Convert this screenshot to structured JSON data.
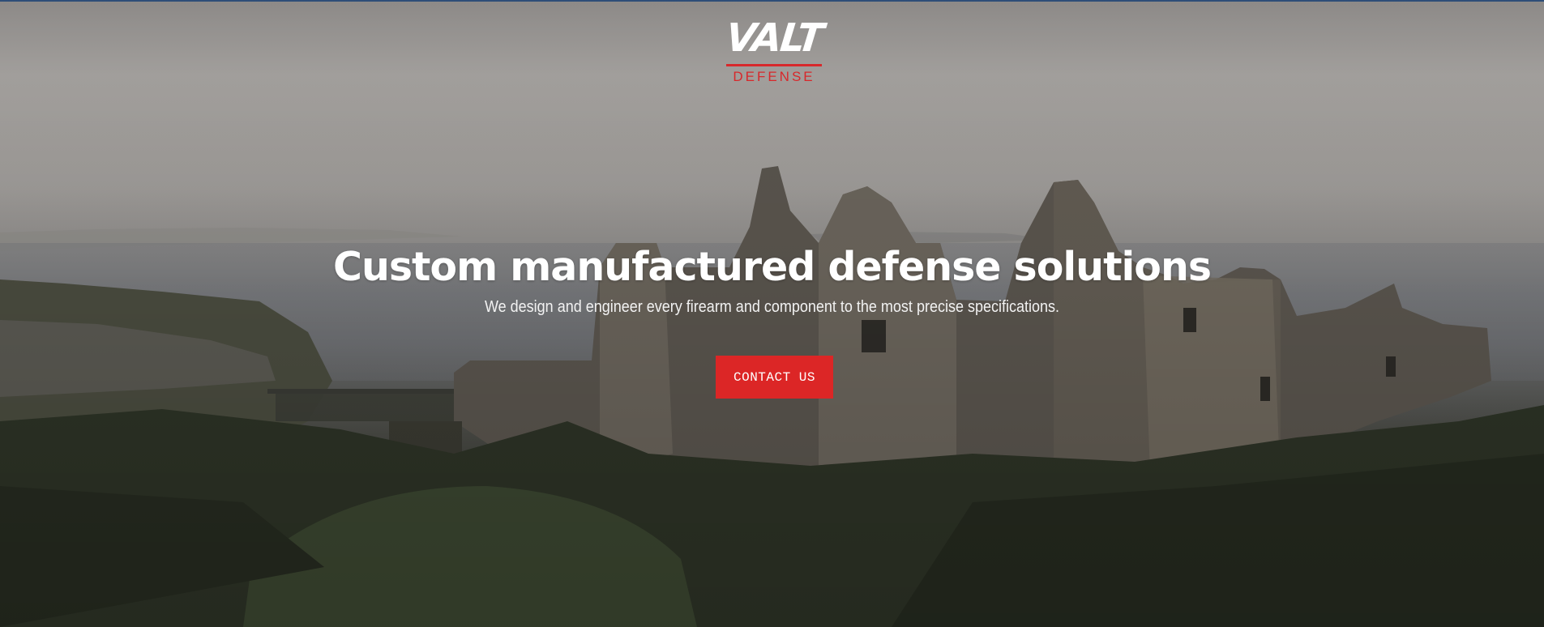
{
  "brand": {
    "logo_word": "VALT",
    "logo_sub": "DEFENSE",
    "accent_color": "#dc2626"
  },
  "hero": {
    "headline": "Custom manufactured defense solutions",
    "subheadline": "We design and engineer every firearm and component to the most precise specifications.",
    "cta_label": "CONTACT US",
    "background_image": "castle-ruins-on-coastal-cliff"
  }
}
